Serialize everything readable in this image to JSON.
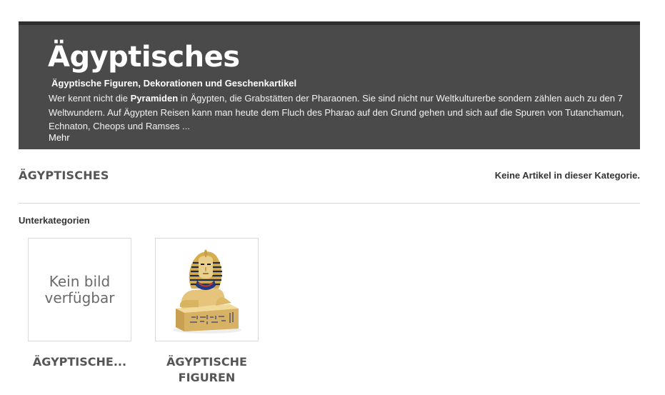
{
  "banner": {
    "title": "Ägyptisches",
    "subtitle": "Ägyptische Figuren, Dekorationen und Geschenkartikel",
    "text_before": "Wer kennt nicht die ",
    "text_bold": "Pyramiden",
    "text_after": " in Ägypten, die Grabstätten der Pharaonen. Sie sind nicht nur Weltkulturerbe sondern zählen auch zu den 7 Weltwundern. Auf Ägypten Reisen kann man heute dem Fluch des Pharao auf den Grund gehen und sich auf die Spuren von Tutanchamun, Echnaton, Cheops und Ramses ...",
    "more_link": "Mehr"
  },
  "category": {
    "heading": "ÄGYPTISCHES",
    "empty_message": "Keine Artikel in dieser Kategorie."
  },
  "subcategories": {
    "label": "Unterkategorien",
    "items": [
      {
        "name": "ÄGYPTISCHE...",
        "no_image_text": "Kein bild verfügbar",
        "image_icon": "placeholder"
      },
      {
        "name": "ÄGYPTISCHE FIGUREN",
        "image_icon": "sphinx-figurine-icon"
      }
    ]
  },
  "colors": {
    "banner_bg": "#4a4a4a",
    "banner_border": "#2f2f2f",
    "heading_text": "#555555",
    "gold": "#d9b460"
  }
}
